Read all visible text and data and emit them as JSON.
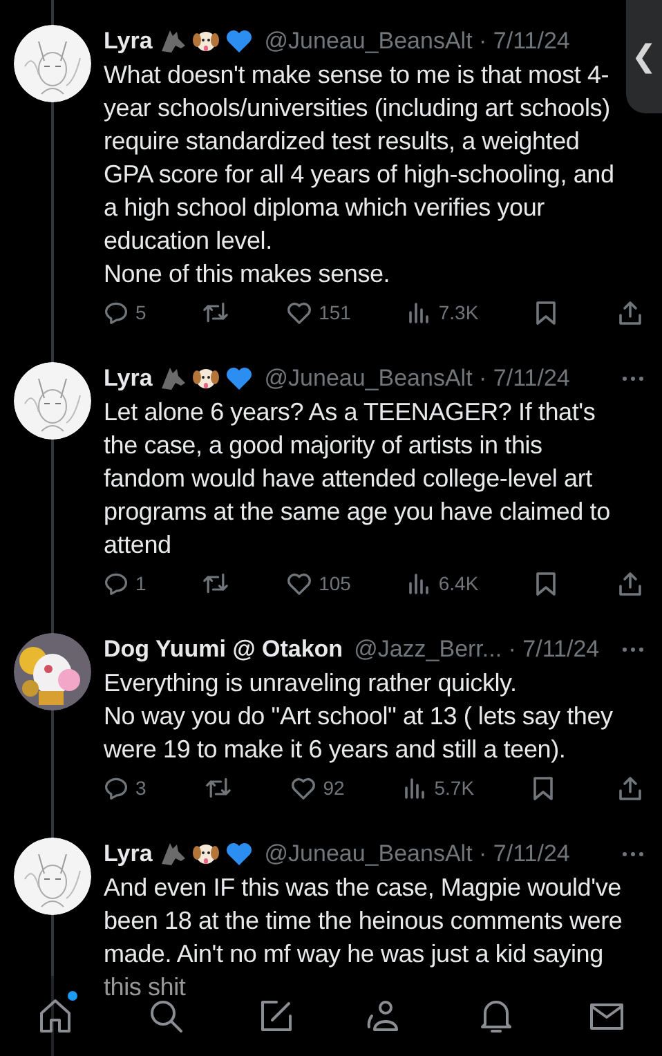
{
  "side_handle": {
    "label": "❮"
  },
  "tweets": [
    {
      "name": "Lyra",
      "badges": true,
      "meta": "@Juneau_BeansAlt · 7/11/24",
      "more": false,
      "text": "What doesn't make sense to me is that most 4-year schools/universities (including art schools) require standardized test results, a weighted GPA score for all 4 years of high-schooling, and a high school diploma which verifies your education level.\nNone of this makes sense.",
      "replies": "5",
      "likes": "151",
      "views": "7.3K"
    },
    {
      "name": "Lyra",
      "badges": true,
      "meta": "@Juneau_BeansAlt · 7/11/24",
      "more": true,
      "text": "Let alone 6 years? As a TEENAGER? If that's the case, a good majority of artists in this fandom would have attended college-level art programs at the same age you have claimed to attend",
      "replies": "1",
      "likes": "105",
      "views": "6.4K"
    },
    {
      "name": "Dog Yuumi @ Otakon",
      "badges": false,
      "meta": "@Jazz_Berr... · 7/11/24",
      "more": true,
      "text": "Everything is unraveling rather quickly.\nNo way you do \"Art school\" at 13 ( lets say they were 19 to make it 6 years and still a teen).",
      "replies": "3",
      "likes": "92",
      "views": "5.7K"
    },
    {
      "name": "Lyra",
      "badges": true,
      "meta": "@Juneau_BeansAlt · 7/11/24",
      "more": true,
      "text": "And even IF this was the case, Magpie would've been 18 at the time the heinous comments were made. Ain't no mf way he was just a kid saying this shit"
    }
  ],
  "nav": [
    {
      "kind": "home",
      "selected": true
    },
    {
      "kind": "search",
      "selected": false
    },
    {
      "kind": "compose",
      "selected": false
    },
    {
      "kind": "people",
      "selected": false
    },
    {
      "kind": "bell",
      "selected": false
    },
    {
      "kind": "mail",
      "selected": false
    }
  ]
}
